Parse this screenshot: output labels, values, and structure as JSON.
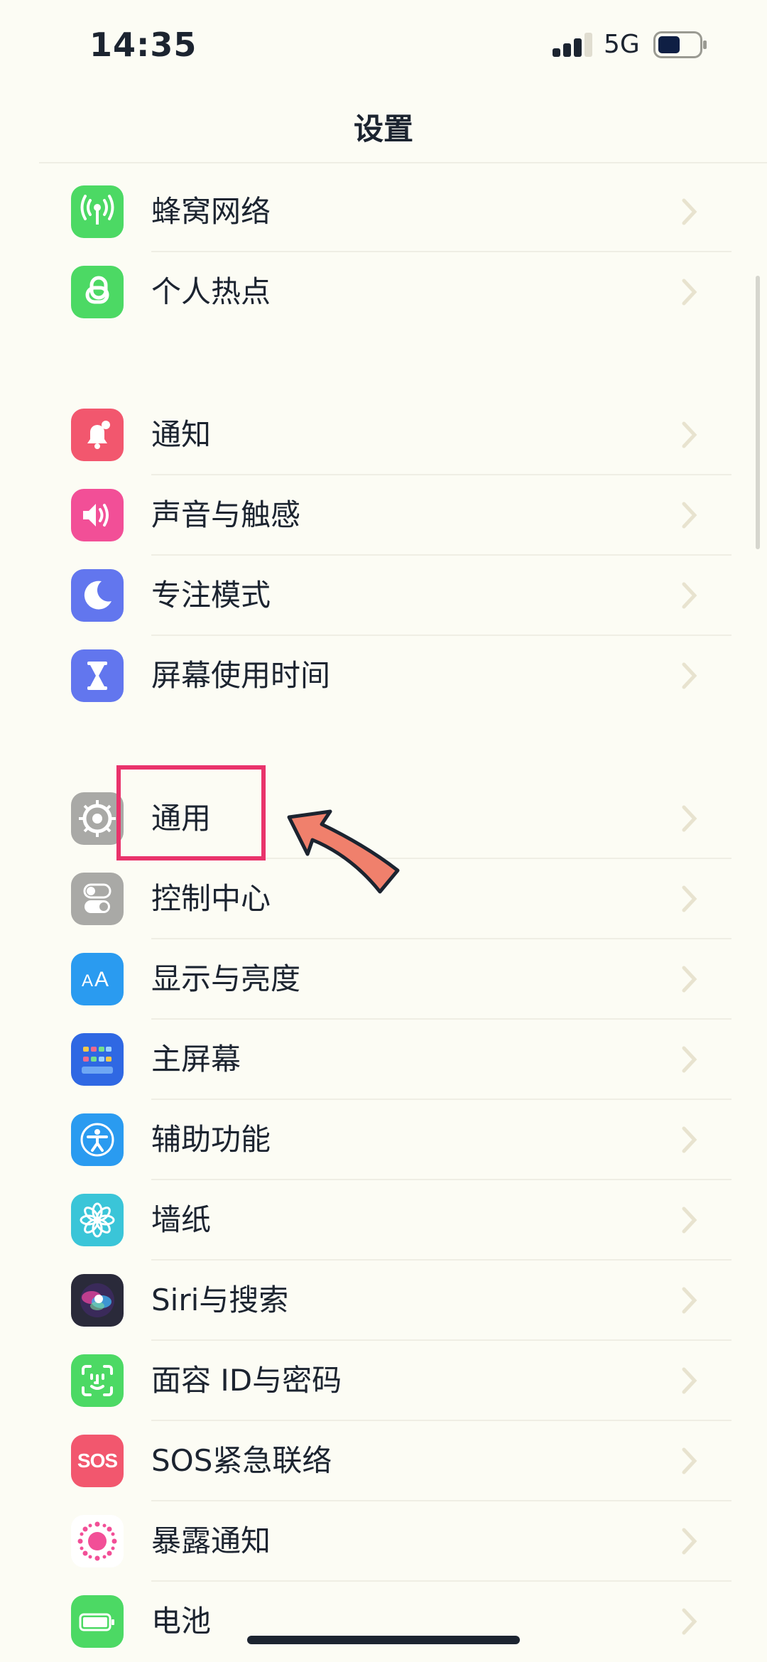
{
  "status_bar": {
    "time": "14:35",
    "network": "5G"
  },
  "header": {
    "title": "设置"
  },
  "rows": [
    {
      "label": "蜂窝网络",
      "icon": "cellular-icon",
      "color": "#4cd964"
    },
    {
      "label": "个人热点",
      "icon": "hotspot-icon",
      "color": "#4cd964"
    },
    {
      "label": "通知",
      "icon": "bell-icon",
      "color": "#f2576e"
    },
    {
      "label": "声音与触感",
      "icon": "speaker-icon",
      "color": "#f24f97"
    },
    {
      "label": "专注模式",
      "icon": "moon-icon",
      "color": "#6276ee"
    },
    {
      "label": "屏幕使用时间",
      "icon": "hourglass-icon",
      "color": "#6276ee"
    },
    {
      "label": "通用",
      "icon": "gear-icon",
      "color": "#a9a9a6"
    },
    {
      "label": "控制中心",
      "icon": "toggles-icon",
      "color": "#a9a9a6"
    },
    {
      "label": "显示与亮度",
      "icon": "text-size-icon",
      "color": "#2a9bf0"
    },
    {
      "label": "主屏幕",
      "icon": "home-grid-icon",
      "color": "#2f68e3"
    },
    {
      "label": "辅助功能",
      "icon": "accessibility-icon",
      "color": "#2a9bf0"
    },
    {
      "label": "墙纸",
      "icon": "flower-icon",
      "color": "#3ac5d8"
    },
    {
      "label": "Siri与搜索",
      "icon": "siri-icon",
      "color": "#2a2a3a"
    },
    {
      "label": "面容 ID与密码",
      "icon": "face-id-icon",
      "color": "#4cd964"
    },
    {
      "label": "SOS紧急联络",
      "icon": "sos-icon",
      "color": "#f2576e",
      "icon_text": "SOS"
    },
    {
      "label": "暴露通知",
      "icon": "exposure-icon",
      "color": "#ffffff"
    },
    {
      "label": "电池",
      "icon": "battery-icon",
      "color": "#4cd964"
    }
  ],
  "annotation": {
    "highlight_color": "#e9336b",
    "arrow_color": "#f0806c"
  }
}
